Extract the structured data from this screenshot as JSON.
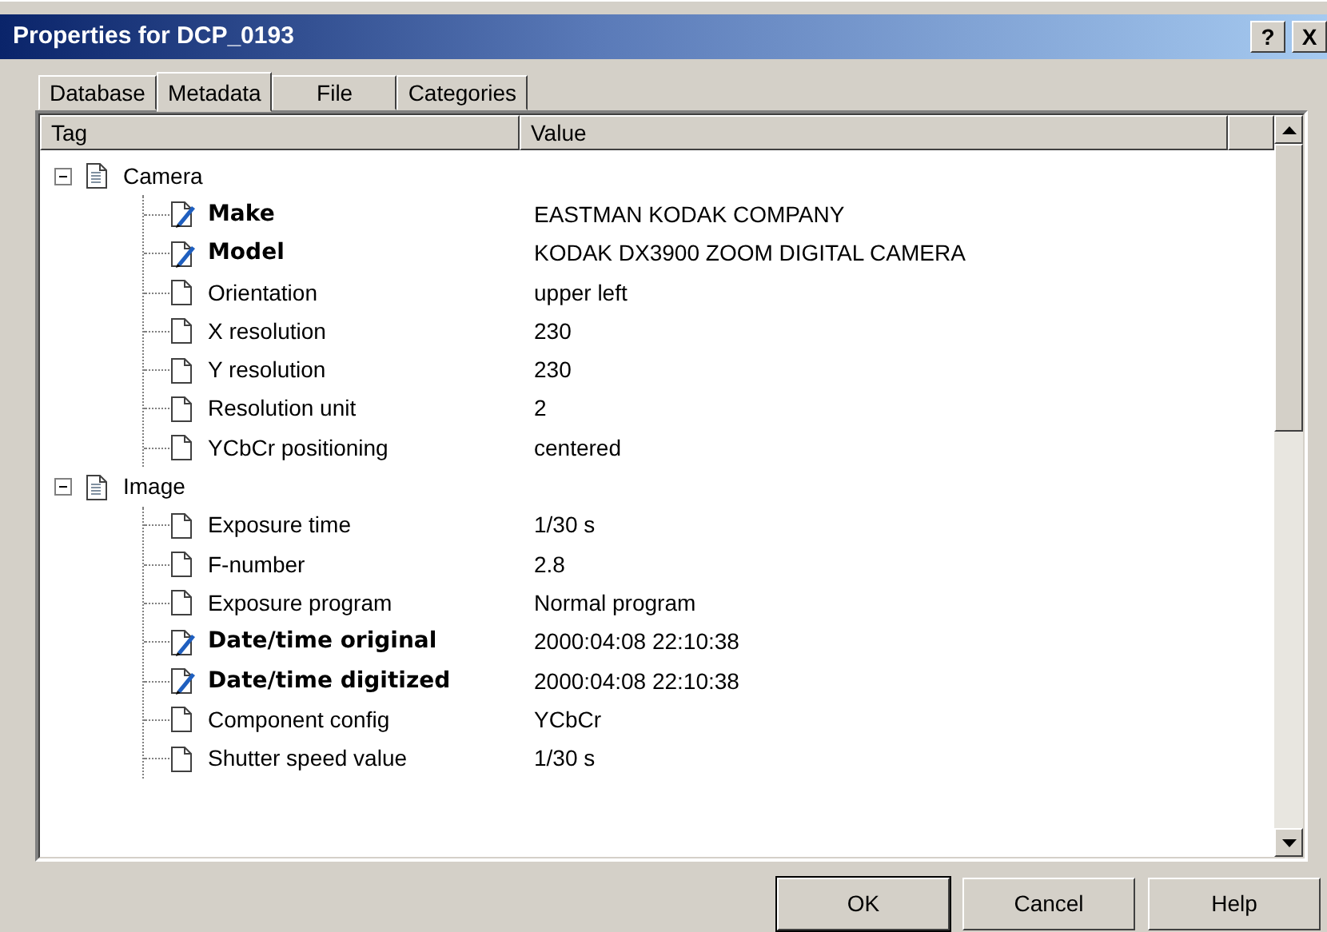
{
  "window": {
    "title": "Properties for DCP_0193",
    "title_buttons": [
      "?",
      "X"
    ]
  },
  "tabs": [
    {
      "label": "Database",
      "selected": false
    },
    {
      "label": "Metadata",
      "selected": true
    },
    {
      "label": "File",
      "selected": false
    },
    {
      "label": "Categories",
      "selected": false
    }
  ],
  "table": {
    "columns": [
      "Tag",
      "Value"
    ],
    "groups": [
      {
        "label": "Camera",
        "expanded": true,
        "children": [
          {
            "tag": "Make",
            "value": "EASTMAN KODAK COMPANY",
            "edited": true
          },
          {
            "tag": "Model",
            "value": "KODAK DX3900 ZOOM DIGITAL CAMERA",
            "edited": true
          },
          {
            "tag": "Orientation",
            "value": "upper left",
            "edited": false
          },
          {
            "tag": "X resolution",
            "value": "230",
            "edited": false
          },
          {
            "tag": "Y resolution",
            "value": "230",
            "edited": false
          },
          {
            "tag": "Resolution unit",
            "value": "2",
            "edited": false
          },
          {
            "tag": "YCbCr positioning",
            "value": "centered",
            "edited": false
          }
        ]
      },
      {
        "label": "Image",
        "expanded": true,
        "children": [
          {
            "tag": "Exposure time",
            "value": "1/30 s",
            "edited": false
          },
          {
            "tag": "F-number",
            "value": "2.8",
            "edited": false
          },
          {
            "tag": "Exposure program",
            "value": "Normal program",
            "edited": false
          },
          {
            "tag": "Date/time original",
            "value": "2000:04:08 22:10:38",
            "edited": true
          },
          {
            "tag": "Date/time digitized",
            "value": "2000:04:08 22:10:38",
            "edited": true
          },
          {
            "tag": "Component config",
            "value": "YCbCr",
            "edited": false
          },
          {
            "tag": "Shutter speed value",
            "value": "1/30 s",
            "edited": false
          }
        ]
      }
    ]
  },
  "buttons": [
    {
      "label": "OK",
      "default": true
    },
    {
      "label": "Cancel",
      "default": false
    },
    {
      "label": "Help",
      "default": false
    }
  ]
}
